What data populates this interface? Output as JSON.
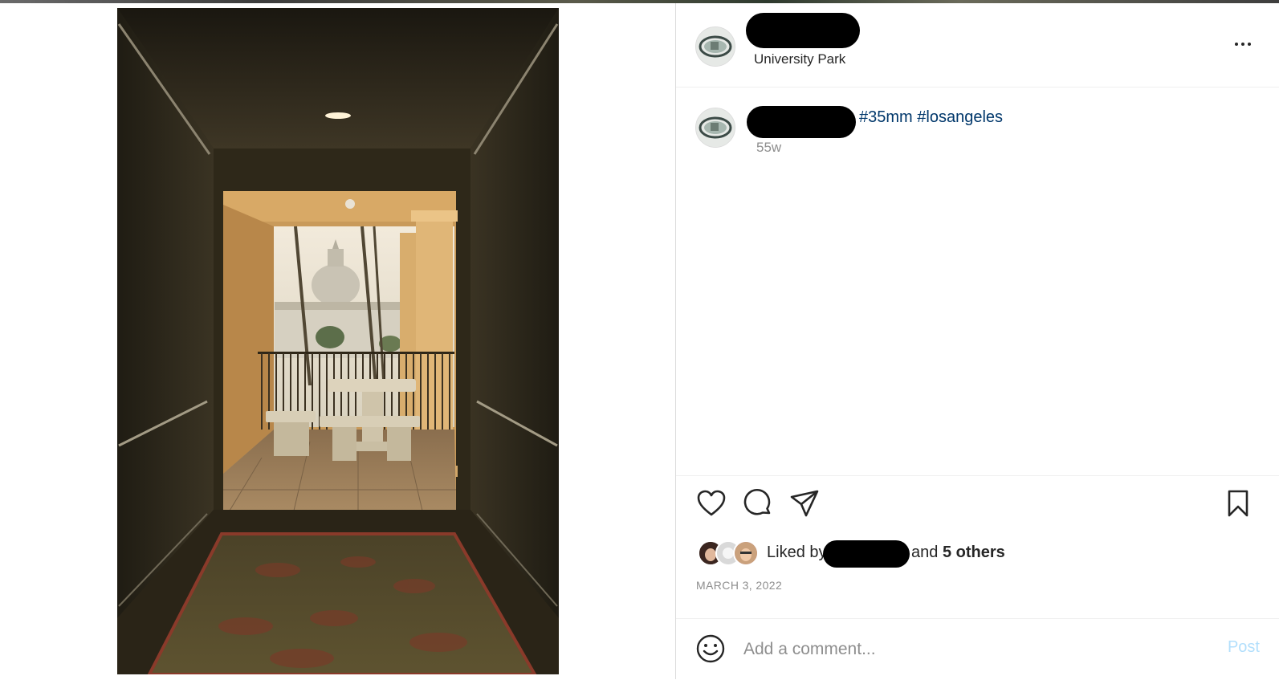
{
  "post": {
    "location": "University Park",
    "caption_hashtags": [
      "#35mm",
      "#losangeles"
    ],
    "age": "55w",
    "date": "MARCH 3, 2022"
  },
  "likes": {
    "liked_by_prefix": "Liked by",
    "and_text": "and",
    "others_text": "5 others"
  },
  "comment": {
    "placeholder": "Add a comment...",
    "post_label": "Post"
  },
  "icons": {
    "more": "more-options-icon",
    "like": "heart-icon",
    "comment": "comment-icon",
    "share": "paper-plane-icon",
    "save": "bookmark-icon",
    "emoji": "smiley-icon"
  },
  "colors": {
    "hashtag": "#00376b",
    "muted": "#8e8e8e",
    "post_button": "#b2dffc",
    "text": "#262626"
  }
}
